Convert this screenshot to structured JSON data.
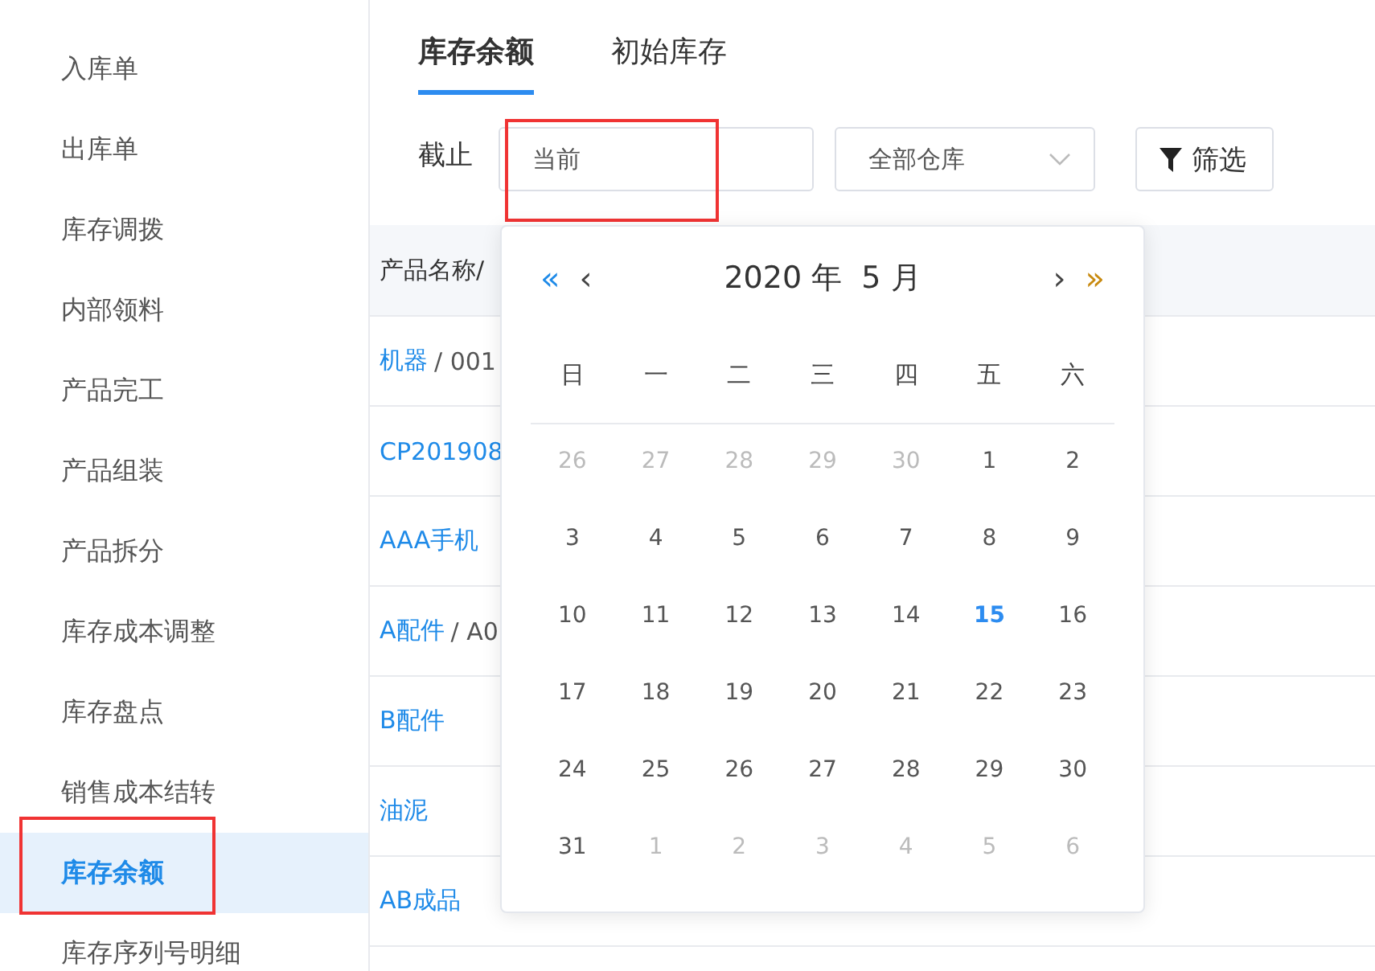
{
  "sidebar": {
    "items": [
      {
        "label": "入库单",
        "selected": false,
        "highlighted": false
      },
      {
        "label": "出库单",
        "selected": false,
        "highlighted": false
      },
      {
        "label": "库存调拨",
        "selected": false,
        "highlighted": false
      },
      {
        "label": "内部领料",
        "selected": false,
        "highlighted": false
      },
      {
        "label": "产品完工",
        "selected": false,
        "highlighted": false
      },
      {
        "label": "产品组装",
        "selected": false,
        "highlighted": false
      },
      {
        "label": "产品拆分",
        "selected": false,
        "highlighted": false
      },
      {
        "label": "库存成本调整",
        "selected": false,
        "highlighted": false
      },
      {
        "label": "库存盘点",
        "selected": false,
        "highlighted": false
      },
      {
        "label": "销售成本结转",
        "selected": false,
        "highlighted": false
      },
      {
        "label": "库存余额",
        "selected": true,
        "highlighted": true
      },
      {
        "label": "库存序列号明细",
        "selected": false,
        "highlighted": false
      }
    ]
  },
  "tabs": [
    {
      "label": "库存余额",
      "selected": true
    },
    {
      "label": "初始库存",
      "selected": false
    }
  ],
  "filters": {
    "date_label": "截止",
    "date_field": {
      "placeholder": "当前",
      "highlighted": true
    },
    "warehouse_select": {
      "value": "全部仓库"
    },
    "filter_button": "筛选"
  },
  "table": {
    "columns": [
      "产品名称/"
    ],
    "rows": [
      {
        "name": "机器",
        "code": "/ 001"
      },
      {
        "name": "CP201908"
      },
      {
        "name": "AAA手机"
      },
      {
        "name": "A配件",
        "code": "/ A0"
      },
      {
        "name": "B配件"
      },
      {
        "name": "油泥"
      },
      {
        "name": "AB成品"
      }
    ]
  },
  "date_picker": {
    "title": "2020 年  5 月",
    "prev_year": "«",
    "prev_month": "‹",
    "next_month": "›",
    "next_year": "»",
    "weekdays": [
      "日",
      "一",
      "二",
      "三",
      "四",
      "五",
      "六"
    ],
    "days": [
      {
        "label": "26",
        "muted": true,
        "selected": false
      },
      {
        "label": "27",
        "muted": true,
        "selected": false
      },
      {
        "label": "28",
        "muted": true,
        "selected": false
      },
      {
        "label": "29",
        "muted": true,
        "selected": false
      },
      {
        "label": "30",
        "muted": true,
        "selected": false
      },
      {
        "label": "1",
        "muted": false,
        "selected": false
      },
      {
        "label": "2",
        "muted": false,
        "selected": false
      },
      {
        "label": "3",
        "muted": false,
        "selected": false
      },
      {
        "label": "4",
        "muted": false,
        "selected": false
      },
      {
        "label": "5",
        "muted": false,
        "selected": false
      },
      {
        "label": "6",
        "muted": false,
        "selected": false
      },
      {
        "label": "7",
        "muted": false,
        "selected": false
      },
      {
        "label": "8",
        "muted": false,
        "selected": false
      },
      {
        "label": "9",
        "muted": false,
        "selected": false
      },
      {
        "label": "10",
        "muted": false,
        "selected": false
      },
      {
        "label": "11",
        "muted": false,
        "selected": false
      },
      {
        "label": "12",
        "muted": false,
        "selected": false
      },
      {
        "label": "13",
        "muted": false,
        "selected": false
      },
      {
        "label": "14",
        "muted": false,
        "selected": false
      },
      {
        "label": "15",
        "muted": false,
        "selected": true
      },
      {
        "label": "16",
        "muted": false,
        "selected": false
      },
      {
        "label": "17",
        "muted": false,
        "selected": false
      },
      {
        "label": "18",
        "muted": false,
        "selected": false
      },
      {
        "label": "19",
        "muted": false,
        "selected": false
      },
      {
        "label": "20",
        "muted": false,
        "selected": false
      },
      {
        "label": "21",
        "muted": false,
        "selected": false
      },
      {
        "label": "22",
        "muted": false,
        "selected": false
      },
      {
        "label": "23",
        "muted": false,
        "selected": false
      },
      {
        "label": "24",
        "muted": false,
        "selected": false
      },
      {
        "label": "25",
        "muted": false,
        "selected": false
      },
      {
        "label": "26",
        "muted": false,
        "selected": false
      },
      {
        "label": "27",
        "muted": false,
        "selected": false
      },
      {
        "label": "28",
        "muted": false,
        "selected": false
      },
      {
        "label": "29",
        "muted": false,
        "selected": false
      },
      {
        "label": "30",
        "muted": false,
        "selected": false
      },
      {
        "label": "31",
        "muted": false,
        "selected": false
      },
      {
        "label": "1",
        "muted": true,
        "selected": false
      },
      {
        "label": "2",
        "muted": true,
        "selected": false
      },
      {
        "label": "3",
        "muted": true,
        "selected": false
      },
      {
        "label": "4",
        "muted": true,
        "selected": false
      },
      {
        "label": "5",
        "muted": true,
        "selected": false
      },
      {
        "label": "6",
        "muted": true,
        "selected": false
      }
    ]
  }
}
